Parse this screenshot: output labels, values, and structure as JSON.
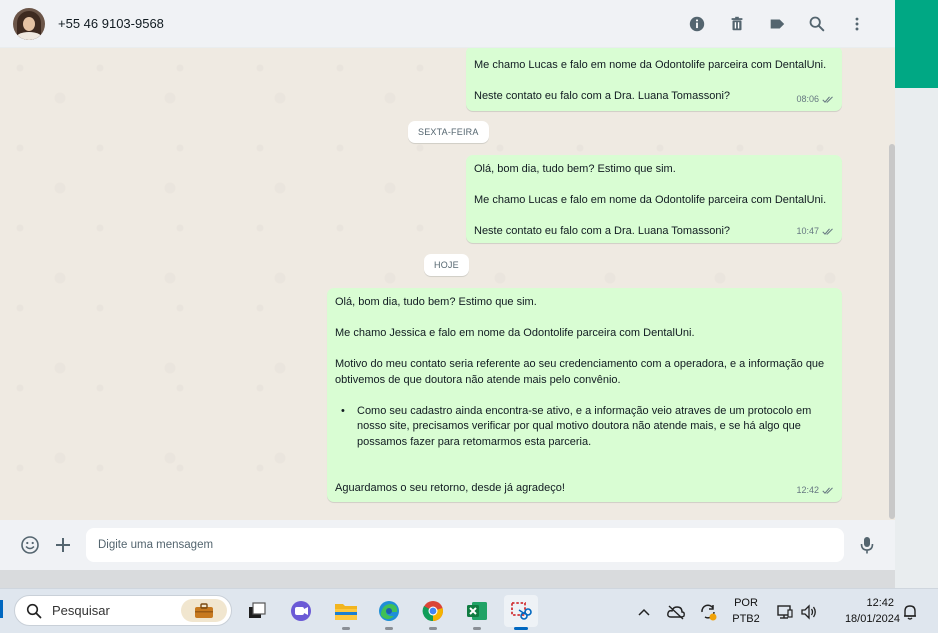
{
  "header": {
    "contact_name": "+55 46 9103-9568",
    "icons": [
      "info-icon",
      "trash-icon",
      "label-icon",
      "search-icon",
      "more-vertical-icon"
    ]
  },
  "messages": [
    {
      "paragraphs": [
        "Me chamo Lucas e falo em nome da Odontolife parceira com DentalUni.",
        "",
        "Neste contato eu falo com a Dra. Luana Tomassoni?"
      ],
      "time": "08:06",
      "status": "double-check"
    },
    {
      "paragraphs": [
        "Olá, bom dia, tudo bem? Estimo que sim.",
        "",
        "Me chamo Lucas e falo em nome da Odontolife parceira com DentalUni.",
        "",
        "Neste contato eu falo com a Dra. Luana Tomassoni?"
      ],
      "time": "10:47",
      "status": "double-check"
    },
    {
      "paragraphs": [
        "Olá, bom dia, tudo bem? Estimo que sim.",
        "",
        "Me chamo Jessica e falo em nome da Odontolife parceira com DentalUni.",
        "",
        "Motivo do meu contato seria referente ao seu credenciamento com a operadora, e a informação que obtivemos de que doutora não atende mais pelo convênio.",
        ""
      ],
      "bullet": "Como seu cadastro ainda encontra-se ativo, e a informação veio atraves de um protocolo em nosso site, precisamos verificar por qual motivo doutora não atende mais, e se há algo que possamos fazer para retomarmos esta parceria.",
      "closing": "Aguardamos o seu retorno, desde já agradeço!",
      "time": "12:42",
      "status": "double-check"
    }
  ],
  "date_separators": [
    "SEXTA-FEIRA",
    "HOJE"
  ],
  "composer": {
    "placeholder": "Digite uma mensagem",
    "icons": [
      "emoji-icon",
      "plus-icon",
      "microphone-icon"
    ]
  },
  "taskbar": {
    "search_label": "Pesquisar",
    "apps": [
      "task-view-icon",
      "teams-icon",
      "file-explorer-icon",
      "edge-icon",
      "chrome-icon",
      "excel-icon",
      "snipping-tool-icon"
    ],
    "language_line1": "POR",
    "language_line2": "PTB2",
    "time": "12:42",
    "date": "18/01/2024"
  },
  "colors": {
    "outgoing_bubble": "#d9fdd3",
    "chat_background": "#efeae2",
    "header_background": "#f0f2f5",
    "accent_green": "#00a884",
    "read_check": "#667781"
  }
}
